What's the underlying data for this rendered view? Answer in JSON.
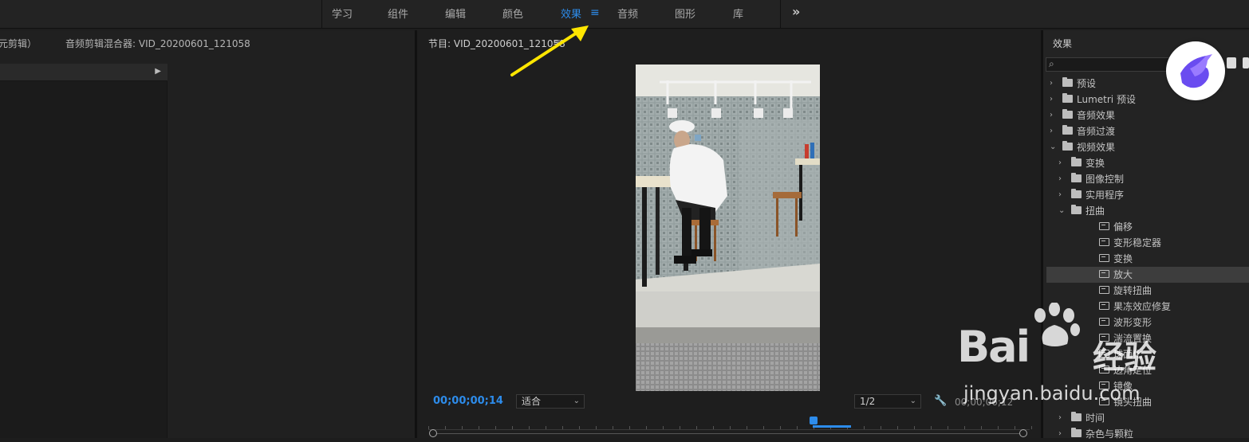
{
  "workspace_tabs": [
    {
      "label": "学习",
      "active": false
    },
    {
      "label": "组件",
      "active": false
    },
    {
      "label": "编辑",
      "active": false
    },
    {
      "label": "颜色",
      "active": false
    },
    {
      "label": "效果",
      "active": true
    },
    {
      "label": "音频",
      "active": false
    },
    {
      "label": "图形",
      "active": false
    },
    {
      "label": "库",
      "active": false
    }
  ],
  "workspace_menu_icon": "≡",
  "workspace_more_icon": "»",
  "left_panel": {
    "clip_label": "元剪辑）",
    "mixer_label": "音频剪辑混合器: VID_20200601_121058"
  },
  "program_panel": {
    "title": "节目: VID_20200601_121058",
    "menu_icon": "≡",
    "timecode": "00;00;00;14",
    "fit_option": "适合",
    "resolution_option": "1/2",
    "end_timecode": "00;00;06;12"
  },
  "effects_panel": {
    "title": "效果",
    "search_placeholder": "",
    "tree": [
      {
        "label": "预设",
        "level": 0,
        "expanded": false,
        "kind": "preset"
      },
      {
        "label": "Lumetri 预设",
        "level": 0,
        "expanded": false,
        "kind": "preset"
      },
      {
        "label": "音频效果",
        "level": 0,
        "expanded": false,
        "kind": "folder"
      },
      {
        "label": "音频过渡",
        "level": 0,
        "expanded": false,
        "kind": "folder"
      },
      {
        "label": "视频效果",
        "level": 0,
        "expanded": true,
        "kind": "folder"
      },
      {
        "label": "变换",
        "level": 1,
        "expanded": false,
        "kind": "folder"
      },
      {
        "label": "图像控制",
        "level": 1,
        "expanded": false,
        "kind": "folder"
      },
      {
        "label": "实用程序",
        "level": 1,
        "expanded": false,
        "kind": "folder"
      },
      {
        "label": "扭曲",
        "level": 1,
        "expanded": true,
        "kind": "folder"
      },
      {
        "label": "偏移",
        "level": 2,
        "kind": "effect"
      },
      {
        "label": "变形稳定器",
        "level": 2,
        "kind": "effect"
      },
      {
        "label": "变换",
        "level": 2,
        "kind": "effect"
      },
      {
        "label": "放大",
        "level": 2,
        "kind": "effect",
        "selected": true
      },
      {
        "label": "旋转扭曲",
        "level": 2,
        "kind": "effect"
      },
      {
        "label": "果冻效应修复",
        "level": 2,
        "kind": "effect"
      },
      {
        "label": "波形变形",
        "level": 2,
        "kind": "effect"
      },
      {
        "label": "湍流置换",
        "level": 2,
        "kind": "effect"
      },
      {
        "label": "球面化",
        "level": 2,
        "kind": "effect"
      },
      {
        "label": "边角定位",
        "level": 2,
        "kind": "effect"
      },
      {
        "label": "镜像",
        "level": 2,
        "kind": "effect"
      },
      {
        "label": "镜头扭曲",
        "level": 2,
        "kind": "effect"
      },
      {
        "label": "时间",
        "level": 1,
        "expanded": false,
        "kind": "folder"
      },
      {
        "label": "杂色与颗粒",
        "level": 1,
        "expanded": false,
        "kind": "folder"
      }
    ]
  },
  "watermark": {
    "brand": "Bai",
    "cn": "经验",
    "url": "jingyan.baidu.com"
  },
  "colors": {
    "accent": "#2d8ceb",
    "arrow": "#ffe600",
    "panel_bg": "#1e1e1e"
  }
}
